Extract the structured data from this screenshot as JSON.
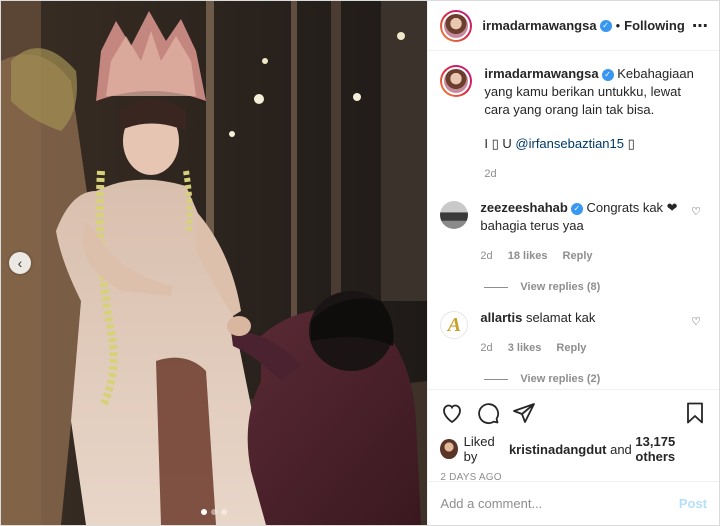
{
  "header": {
    "username": "irmadarmawangsa",
    "separator": "•",
    "follow_status": "Following",
    "more_icon": "⋯"
  },
  "caption": {
    "username": "irmadarmawangsa",
    "text": "Kebahagiaan yang kamu berikan untukku, lewat cara yang orang lain tak bisa.",
    "line2_prefix": "I ▯ U ",
    "mention": "@irfansebaztian15",
    "line2_suffix": " ▯",
    "time": "2d"
  },
  "comments": [
    {
      "username": "zeezeeshahab",
      "text": "Congrats kak ❤ bahagia terus yaa",
      "time": "2d",
      "likes": "18 likes",
      "reply_label": "Reply",
      "view_replies": "View replies (8)"
    },
    {
      "username": "allartis",
      "avatar_letter": "A",
      "text": "selamat kak",
      "time": "2d",
      "likes": "3 likes",
      "reply_label": "Reply",
      "view_replies": "View replies (2)"
    }
  ],
  "likes": {
    "prefix": "Liked by ",
    "user": "kristinadangdut",
    "middle": " and ",
    "count": "13,175 others"
  },
  "post_age": "2 DAYS AGO",
  "add_comment": {
    "placeholder": "Add a comment...",
    "post_label": "Post"
  },
  "photo": {
    "prev_icon": "‹",
    "dot_count": 3,
    "active_dot": 1
  },
  "icons": [
    "heart-icon",
    "comment-icon",
    "share-icon",
    "bookmark-icon",
    "verified-icon",
    "chevron-left-icon"
  ],
  "colors": {
    "link": "#00376b",
    "verified": "#3897f0",
    "muted": "#8e8e8e",
    "post_button": "#b2dffc"
  }
}
